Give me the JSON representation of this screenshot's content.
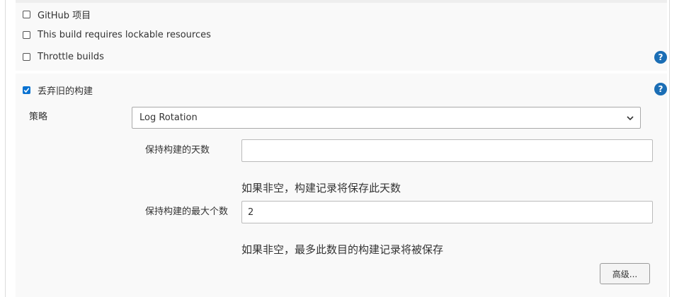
{
  "options": [
    {
      "label": "GitHub 项目",
      "checked": false
    },
    {
      "label": "This build requires lockable resources",
      "checked": false
    },
    {
      "label": "Throttle builds",
      "checked": false
    }
  ],
  "discard": {
    "label": "丢弃旧的构建",
    "checked": true,
    "strategy_label": "策略",
    "strategy_value": "Log Rotation",
    "days_label": "保持构建的天数",
    "days_value": "",
    "days_hint": "如果非空，构建记录将保存此天数",
    "max_label": "保持构建的最大个数",
    "max_value": "2",
    "max_hint": "如果非空，最多此数目的构建记录将被保存",
    "advanced_button": "高级..."
  },
  "help_icon_glyph": "?",
  "colors": {
    "accent": "#0a72d1",
    "help": "#1b6eb5",
    "panel": "#f9f9f9"
  }
}
